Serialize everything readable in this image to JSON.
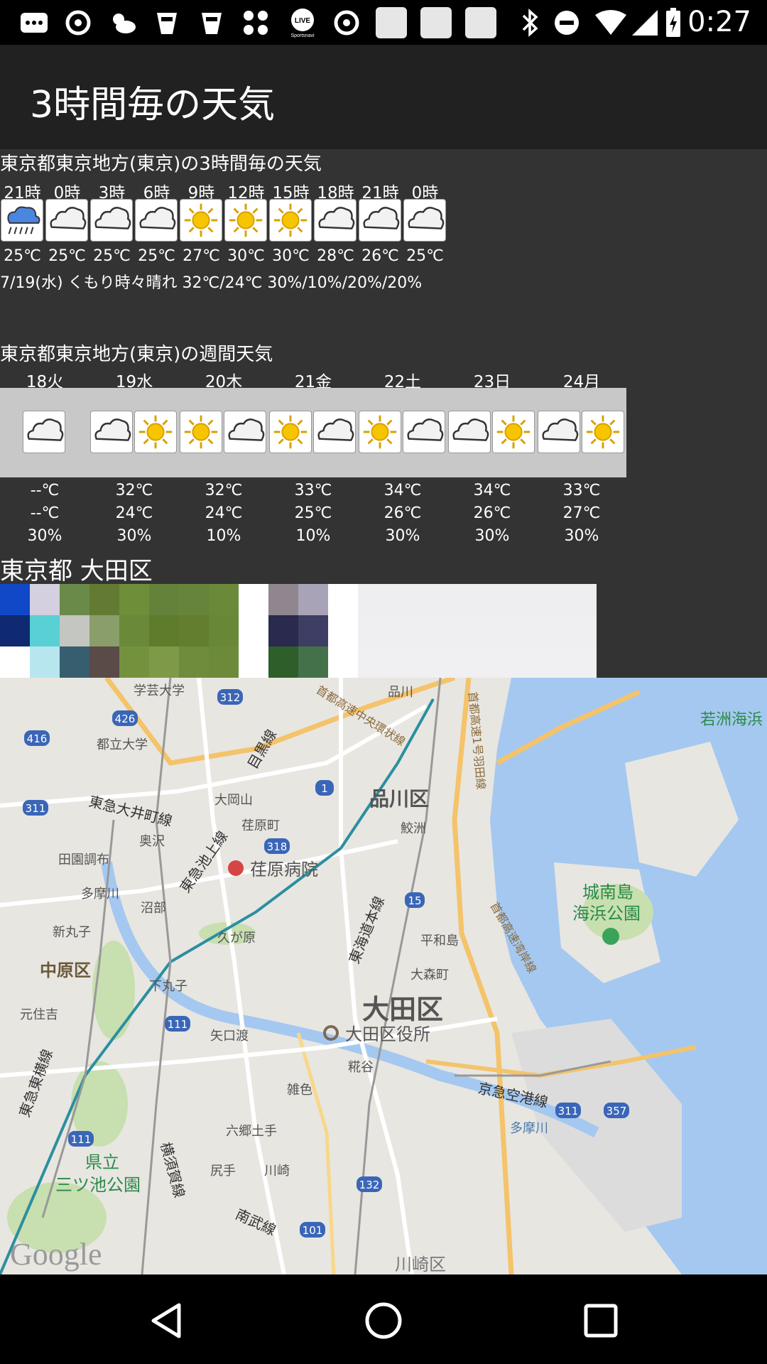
{
  "status_bar": {
    "time": "0:27",
    "icons": [
      "message-icon",
      "search-icon",
      "weather-icon",
      "cup-icon",
      "cup-icon",
      "apps-icon",
      "live-icon",
      "search-icon",
      "blank-square-icon",
      "blank-square-icon",
      "blank-square-icon",
      "bluetooth-icon",
      "dnd-icon",
      "wifi-icon",
      "signal-icon",
      "battery-icon"
    ],
    "live_label": "LIVE",
    "live_sub": "Sportsnavi"
  },
  "app_bar": {
    "title": "3時間毎の天気"
  },
  "hourly": {
    "title": "東京都東京地方(東京)の3時間毎の天気",
    "hours": [
      "21時",
      "0時",
      "3時",
      "6時",
      "9時",
      "12時",
      "15時",
      "18時",
      "21時",
      "0時"
    ],
    "icons": [
      "rain",
      "cloudy",
      "cloudy",
      "cloudy",
      "sunny",
      "sunny",
      "sunny",
      "cloudy",
      "cloudy",
      "cloudy"
    ],
    "temps": [
      "25℃",
      "25℃",
      "25℃",
      "25℃",
      "27℃",
      "30℃",
      "30℃",
      "28℃",
      "26℃",
      "25℃"
    ],
    "summary": "7/19(水) くもり時々晴れ 32℃/24℃ 30%/10%/20%/20%"
  },
  "weekly": {
    "title": "東京都東京地方(東京)の週間天気",
    "days": [
      "18火",
      "19水",
      "20木",
      "21金",
      "22土",
      "23日",
      "24月"
    ],
    "icons": [
      [
        "cloudy"
      ],
      [
        "cloudy",
        "sunny"
      ],
      [
        "sunny",
        "cloudy"
      ],
      [
        "sunny",
        "cloudy"
      ],
      [
        "sunny",
        "cloudy"
      ],
      [
        "cloudy",
        "sunny"
      ],
      [
        "cloudy",
        "sunny"
      ]
    ],
    "high": [
      "--℃",
      "32℃",
      "32℃",
      "33℃",
      "34℃",
      "34℃",
      "33℃"
    ],
    "low": [
      "--℃",
      "24℃",
      "24℃",
      "25℃",
      "26℃",
      "26℃",
      "27℃"
    ],
    "pop": [
      "30%",
      "30%",
      "10%",
      "10%",
      "30%",
      "30%",
      "30%"
    ]
  },
  "location": {
    "name": "東京都 大田区"
  },
  "map": {
    "labels": {
      "shinagawa": "品川区",
      "ota": "大田区",
      "ota_office": "大田区役所",
      "ebara_hospital": "荏原病院",
      "jonanjima": "城南島",
      "kaihin": "海浜公園",
      "wakasu": "若洲海浜",
      "nakahara": "中原区",
      "kenritsu": "県立",
      "mitsuike": "三ツ池公園",
      "kawasaki": "川崎区",
      "gakugei": "学芸大学",
      "toritsu": "都立大学",
      "ookayama": "大岡山",
      "okusawa": "奥沢",
      "denen": "田園調布",
      "tamagawa": "多摩川",
      "numabe": "沼部",
      "shinmaruko": "新丸子",
      "kugahara": "久が原",
      "shimomaruko": "下丸子",
      "yaguchi": "矢口渡",
      "motosumiyoshi": "元住吉",
      "heiwajima": "平和島",
      "omori": "大森町",
      "kojiya": "糀谷",
      "zoshiki": "雑色",
      "rokugo": "六郷土手",
      "shiriate": "尻手",
      "kawasaki_st": "川崎",
      "samezu": "鮫洲",
      "ebaramachi": "荏原町",
      "shinagawa_st": "品川",
      "tamagawa_river": "多摩川",
      "meguro_line": "目黒線",
      "oimachi_line": "東急大井町線",
      "ikegami_line": "東急池上線",
      "tokaido": "東海道本線",
      "keikyu_airport": "京急空港線",
      "toyoko": "東急東横線",
      "yokosuka": "横須賀線",
      "nambu": "南武線",
      "wangan": "首都高速湾岸線",
      "haneda_line": "首都高速1号羽田線",
      "c2": "首都高速中央環状線",
      "r312": "312",
      "r426": "426",
      "r416": "416",
      "r311a": "311",
      "r1": "1",
      "r318": "318",
      "r15": "15",
      "r111a": "111",
      "r111b": "111",
      "r132": "132",
      "r101": "101",
      "r311b": "311",
      "r357": "357",
      "google": "Google"
    }
  },
  "colors": {
    "background": "#333333",
    "app_bar": "#212121",
    "weekly_band": "#c8c8c8",
    "sun": "#f7c400",
    "water": "#a5c8f0",
    "land": "#e8e6e1"
  }
}
